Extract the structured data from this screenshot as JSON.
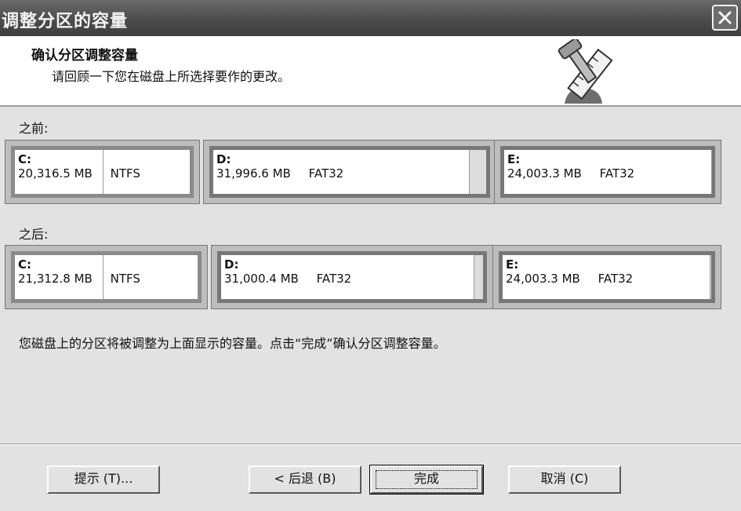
{
  "window": {
    "title": "调整分区的容量"
  },
  "header": {
    "title": "确认分区调整容量",
    "subtitle": "请回顾一下您在磁盘上所选择要作的更改。",
    "icon": "wrench-ruler-icon"
  },
  "before": {
    "label": "之前:",
    "partitions": [
      {
        "letter": "C:",
        "size": "20,316.5 MB",
        "fs": "NTFS"
      },
      {
        "letter": "D:",
        "size": "31,996.6 MB",
        "fs": "FAT32"
      },
      {
        "letter": "E:",
        "size": "24,003.3 MB",
        "fs": "FAT32"
      }
    ]
  },
  "after": {
    "label": "之后:",
    "partitions": [
      {
        "letter": "C:",
        "size": "21,312.8 MB",
        "fs": "NTFS"
      },
      {
        "letter": "D:",
        "size": "31,000.4 MB",
        "fs": "FAT32"
      },
      {
        "letter": "E:",
        "size": "24,003.3 MB",
        "fs": "FAT32"
      }
    ]
  },
  "note": "您磁盘上的分区将被调整为上面显示的容量。点击“完成”确认分区调整容量。",
  "buttons": {
    "hint": "提示 (T)...",
    "back": "< 后退 (B)",
    "finish": "完成",
    "cancel": "取消 (C)"
  }
}
